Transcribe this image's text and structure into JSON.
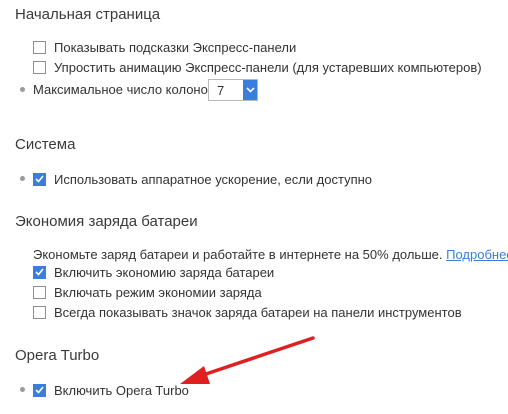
{
  "start_page": {
    "title": "Начальная страница",
    "options": [
      {
        "label": "Показывать подсказки Экспресс-панели",
        "checked": false
      },
      {
        "label": "Упростить анимацию Экспресс-панели (для устаревших компьютеров)",
        "checked": false
      }
    ],
    "columns_label": "Максимальное число колонок:",
    "columns_value": "7"
  },
  "system": {
    "title": "Система",
    "hw_accel_label": "Использовать аппаратное ускорение, если доступно",
    "hw_accel_checked": true
  },
  "battery": {
    "title": "Экономия заряда батареи",
    "description": "Экономьте заряд батареи и работайте в интернете на 50% дольше.",
    "more_link": "Подробнее...",
    "options": [
      {
        "label": "Включить экономию заряда батареи",
        "checked": true
      },
      {
        "label": "Включать режим экономии заряда",
        "checked": false
      },
      {
        "label": "Всегда показывать значок заряда батареи на панели инструментов",
        "checked": false
      }
    ]
  },
  "turbo": {
    "title": "Opera Turbo",
    "enable_label": "Включить Opera Turbo",
    "enable_checked": true
  },
  "colors": {
    "accent": "#3b7ddd",
    "arrow": "#e02020"
  }
}
